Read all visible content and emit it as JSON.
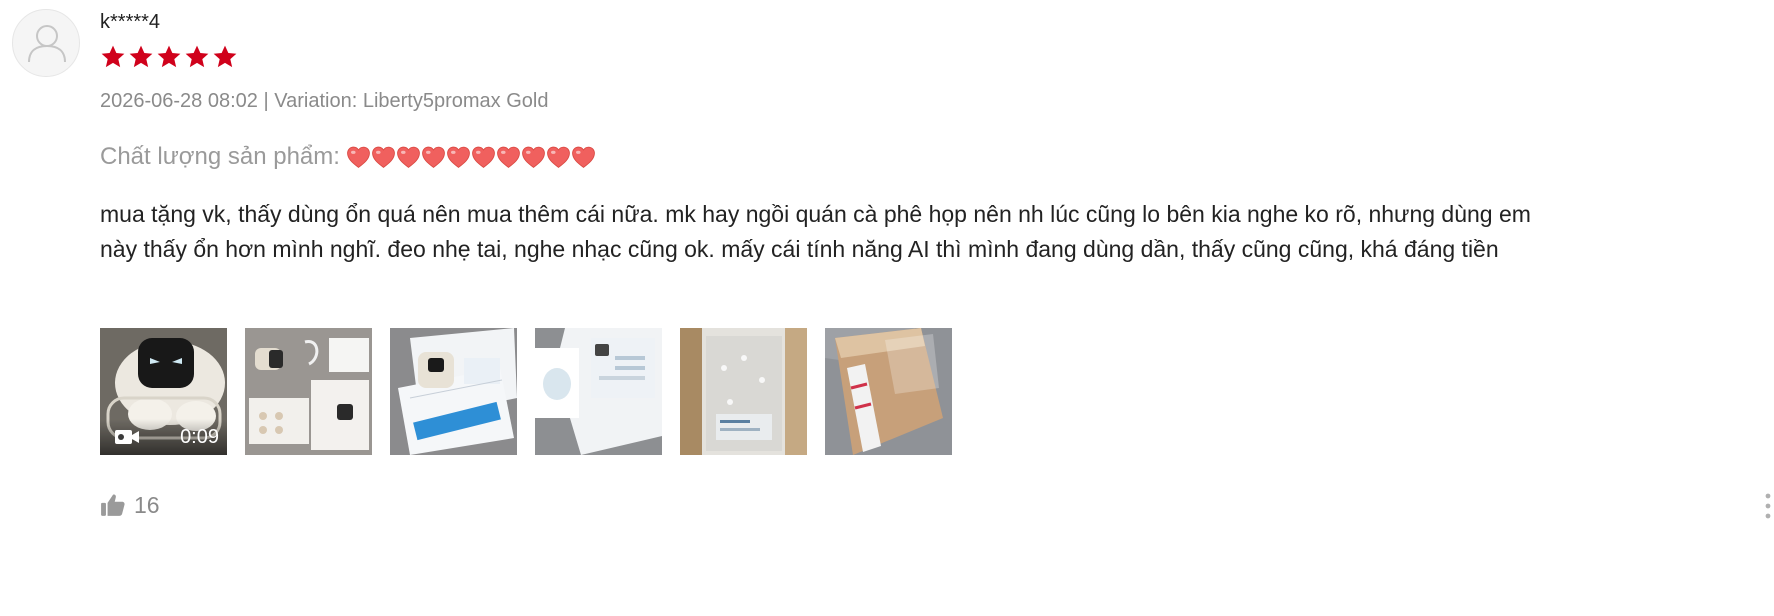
{
  "review": {
    "username": "k*****4",
    "rating": 5,
    "rating_max": 5,
    "star_color": "#d0011b",
    "date": "2026-06-28 08:02",
    "separator": "|",
    "variation_label": "Variation:",
    "variation_value": "Liberty5promax Gold",
    "quality_label": "Chất lượng sản phẩm:",
    "quality_hearts": 10,
    "heart_color": "#f0605e",
    "body": "mua tặng vk, thấy dùng ổn quá nên mua thêm cái nữa. mk hay ngồi quán cà phê họp nên nh lúc cũng lo bên kia nghe ko rõ, nhưng dùng em này thấy ổn hơn mình nghĩ. đeo nhẹ tai, nghe nhạc cũng ok. mấy cái tính năng AI thì mình đang dùng dần, thấy cũng cũng, khá đáng tiền",
    "media": [
      {
        "type": "video",
        "duration": "0:09",
        "icon": "video-camera-icon"
      },
      {
        "type": "image"
      },
      {
        "type": "image"
      },
      {
        "type": "image"
      },
      {
        "type": "image"
      },
      {
        "type": "image"
      }
    ],
    "like_icon": "thumbs-up-icon",
    "likes": "16",
    "more_icon": "more-vertical-icon"
  }
}
